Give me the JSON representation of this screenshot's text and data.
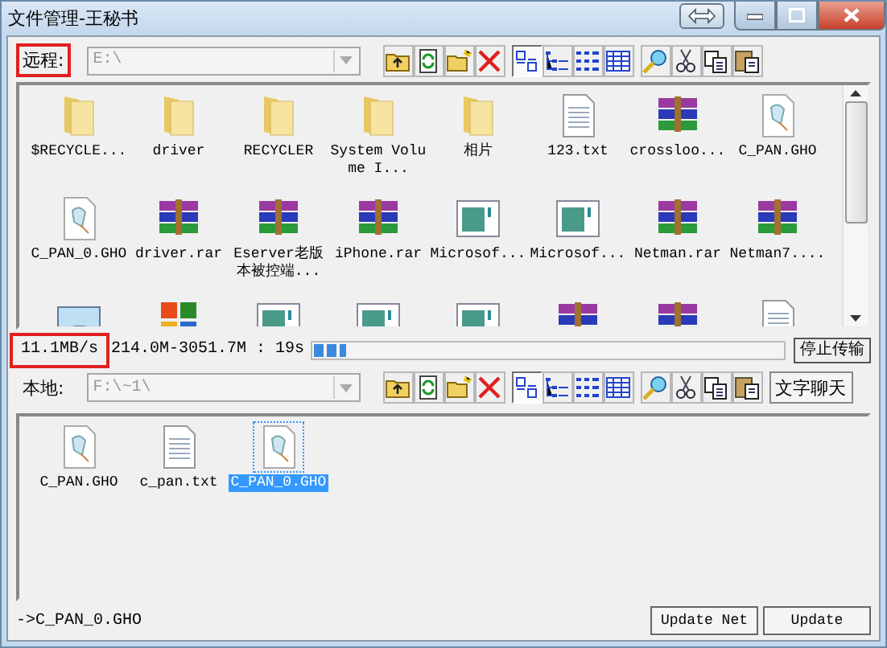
{
  "window": {
    "title": "文件管理-王秘书"
  },
  "remote": {
    "label": "远程:",
    "highlighted": true,
    "path": "E:\\",
    "toolbar": [
      {
        "kind": "up",
        "selected": false
      },
      {
        "kind": "refresh",
        "selected": false
      },
      {
        "kind": "newfolder",
        "selected": false
      },
      {
        "kind": "delete",
        "selected": false
      },
      {
        "kind": "largeicons",
        "selected": true
      },
      {
        "kind": "smallicons",
        "selected": false
      },
      {
        "kind": "list",
        "selected": false
      },
      {
        "kind": "details",
        "selected": false
      },
      {
        "kind": "search",
        "selected": false
      },
      {
        "kind": "cut",
        "selected": false
      },
      {
        "kind": "copy",
        "selected": false
      },
      {
        "kind": "paste",
        "selected": false
      }
    ],
    "files": [
      {
        "kind": "folder",
        "name": "$RECYCLE...",
        "selected": false
      },
      {
        "kind": "folder",
        "name": "driver",
        "selected": false
      },
      {
        "kind": "folder",
        "name": "RECYCLER",
        "selected": false
      },
      {
        "kind": "folder",
        "name": "System Volume I...",
        "selected": false
      },
      {
        "kind": "folder",
        "name": "相片",
        "selected": false
      },
      {
        "kind": "text",
        "name": "123.txt",
        "selected": false
      },
      {
        "kind": "archive",
        "name": "crossloo...",
        "selected": false
      },
      {
        "kind": "ghost",
        "name": "C_PAN.GHO",
        "selected": false
      },
      {
        "kind": "ghost",
        "name": "C_PAN_0.GHO",
        "selected": false
      },
      {
        "kind": "archive",
        "name": "driver.rar",
        "selected": false
      },
      {
        "kind": "archive",
        "name": "Eserver老版本被控端...",
        "selected": false
      },
      {
        "kind": "archive",
        "name": "iPhone.rar",
        "selected": false
      },
      {
        "kind": "program",
        "name": "Microsof...",
        "selected": false
      },
      {
        "kind": "program",
        "name": "Microsof...",
        "selected": false
      },
      {
        "kind": "archive",
        "name": "Netman.rar",
        "selected": false
      },
      {
        "kind": "archive",
        "name": "Netman7....",
        "selected": false
      },
      {
        "kind": "image",
        "selected": false
      },
      {
        "kind": "office",
        "selected": false
      },
      {
        "kind": "program",
        "selected": false
      },
      {
        "kind": "program",
        "selected": false
      },
      {
        "kind": "program",
        "selected": false
      },
      {
        "kind": "archive",
        "selected": false
      },
      {
        "kind": "archive",
        "selected": false
      },
      {
        "kind": "text",
        "selected": false
      }
    ]
  },
  "transfer": {
    "speed": "11.1MB/s",
    "speed_highlighted": true,
    "progress_text": "214.0M-3051.7M : 19s",
    "level": 0.07,
    "stop_button": "停止传输"
  },
  "local": {
    "label": "本地:",
    "highlighted": false,
    "path": "F:\\~1\\",
    "chat_button": "文字聊天",
    "toolbar": [
      {
        "kind": "up",
        "selected": false
      },
      {
        "kind": "refresh",
        "selected": false
      },
      {
        "kind": "newfolder",
        "selected": false
      },
      {
        "kind": "delete",
        "selected": false
      },
      {
        "kind": "largeicons",
        "selected": true
      },
      {
        "kind": "smallicons",
        "selected": false
      },
      {
        "kind": "list",
        "selected": false
      },
      {
        "kind": "details",
        "selected": false
      },
      {
        "kind": "search",
        "selected": false
      },
      {
        "kind": "cut",
        "selected": false
      },
      {
        "kind": "copy",
        "selected": false
      },
      {
        "kind": "paste",
        "selected": false
      }
    ],
    "files": [
      {
        "kind": "ghost",
        "name": "C_PAN.GHO",
        "selected": false
      },
      {
        "kind": "text",
        "name": "c_pan.txt",
        "selected": false
      },
      {
        "kind": "ghost",
        "name": "C_PAN_0.GHO",
        "selected": true
      }
    ]
  },
  "status_bar": {
    "text": "->C_PAN_0.GHO",
    "buttons": [
      "Update Net",
      "Update"
    ]
  }
}
